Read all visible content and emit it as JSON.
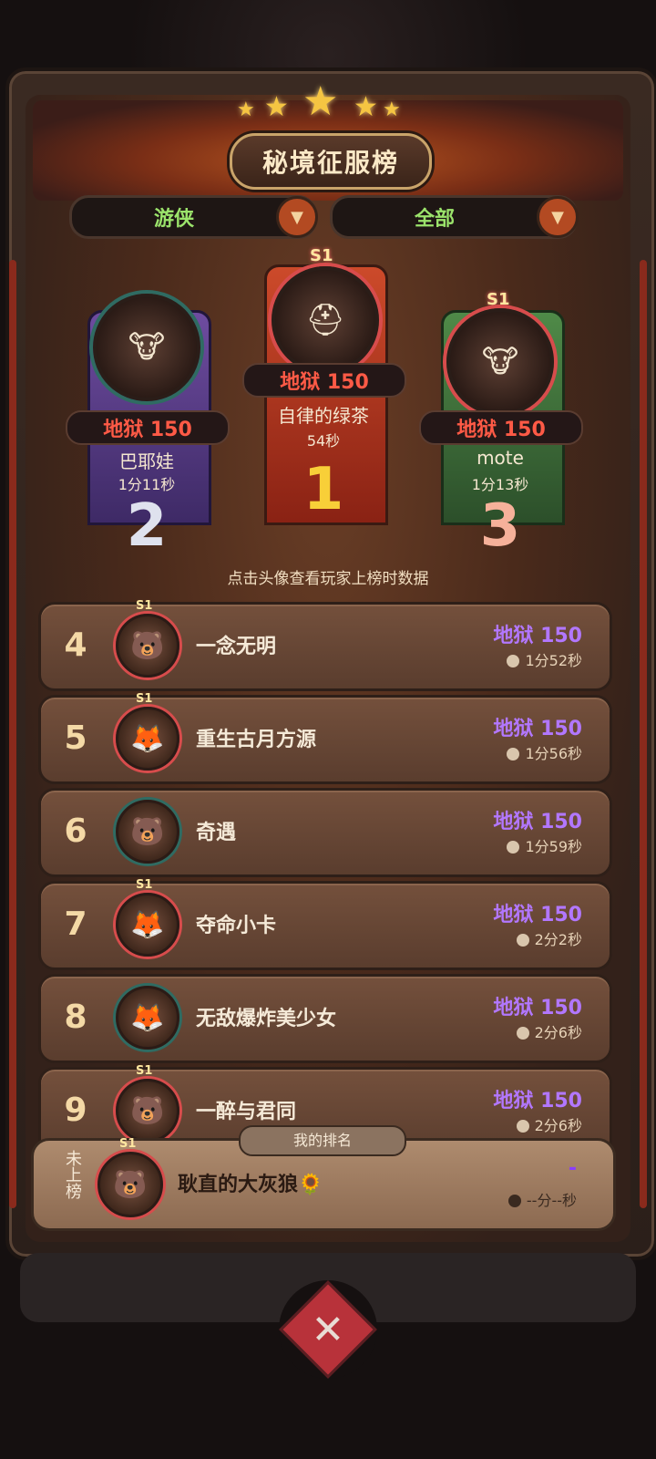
{
  "title": "秘境征服榜",
  "filters": {
    "class_label": "游侠",
    "scope_label": "全部"
  },
  "podium": [
    {
      "rank": "2",
      "difficulty": "地狱 150",
      "name": "巴耶娃",
      "time": "1分11秒",
      "avatar_icon": "cow-hero-icon",
      "season": ""
    },
    {
      "rank": "1",
      "difficulty": "地狱 150",
      "name": "自律的绿茶",
      "time": "54秒",
      "avatar_icon": "helmet-warrior-icon",
      "season": "S1"
    },
    {
      "rank": "3",
      "difficulty": "地狱 150",
      "name": "mote",
      "time": "1分13秒",
      "avatar_icon": "cow-hero-icon",
      "season": "S1"
    }
  ],
  "hint": "点击头像查看玩家上榜时数据",
  "rows": [
    {
      "rank": "4",
      "name": "一念无明",
      "difficulty": "地狱 150",
      "time": "1分52秒",
      "season": "S1"
    },
    {
      "rank": "5",
      "name": "重生古月方源",
      "difficulty": "地狱 150",
      "time": "1分56秒",
      "season": "S1"
    },
    {
      "rank": "6",
      "name": "奇遇",
      "difficulty": "地狱 150",
      "time": "1分59秒",
      "season": ""
    },
    {
      "rank": "7",
      "name": "夺命小卡",
      "difficulty": "地狱 150",
      "time": "2分2秒",
      "season": "S1"
    },
    {
      "rank": "8",
      "name": "无敌爆炸美少女",
      "difficulty": "地狱 150",
      "time": "2分6秒",
      "season": ""
    },
    {
      "rank": "9",
      "name": "一醉与君同",
      "difficulty": "地狱 150",
      "time": "2分6秒",
      "season": "S1"
    }
  ],
  "my_rank": {
    "tag": "我的排名",
    "status": "未上榜",
    "season": "S1",
    "name": "耿直的大灰狼🌻",
    "difficulty": "-",
    "time": "--分--秒"
  },
  "colors": {
    "difficulty_red": "#ff5a46",
    "difficulty_purple": "#b277ff",
    "filter_green": "#9be36b",
    "rank1_banner": "#b53a22",
    "rank2_banner": "#5a3c8a",
    "rank3_banner": "#3c6a3a"
  }
}
